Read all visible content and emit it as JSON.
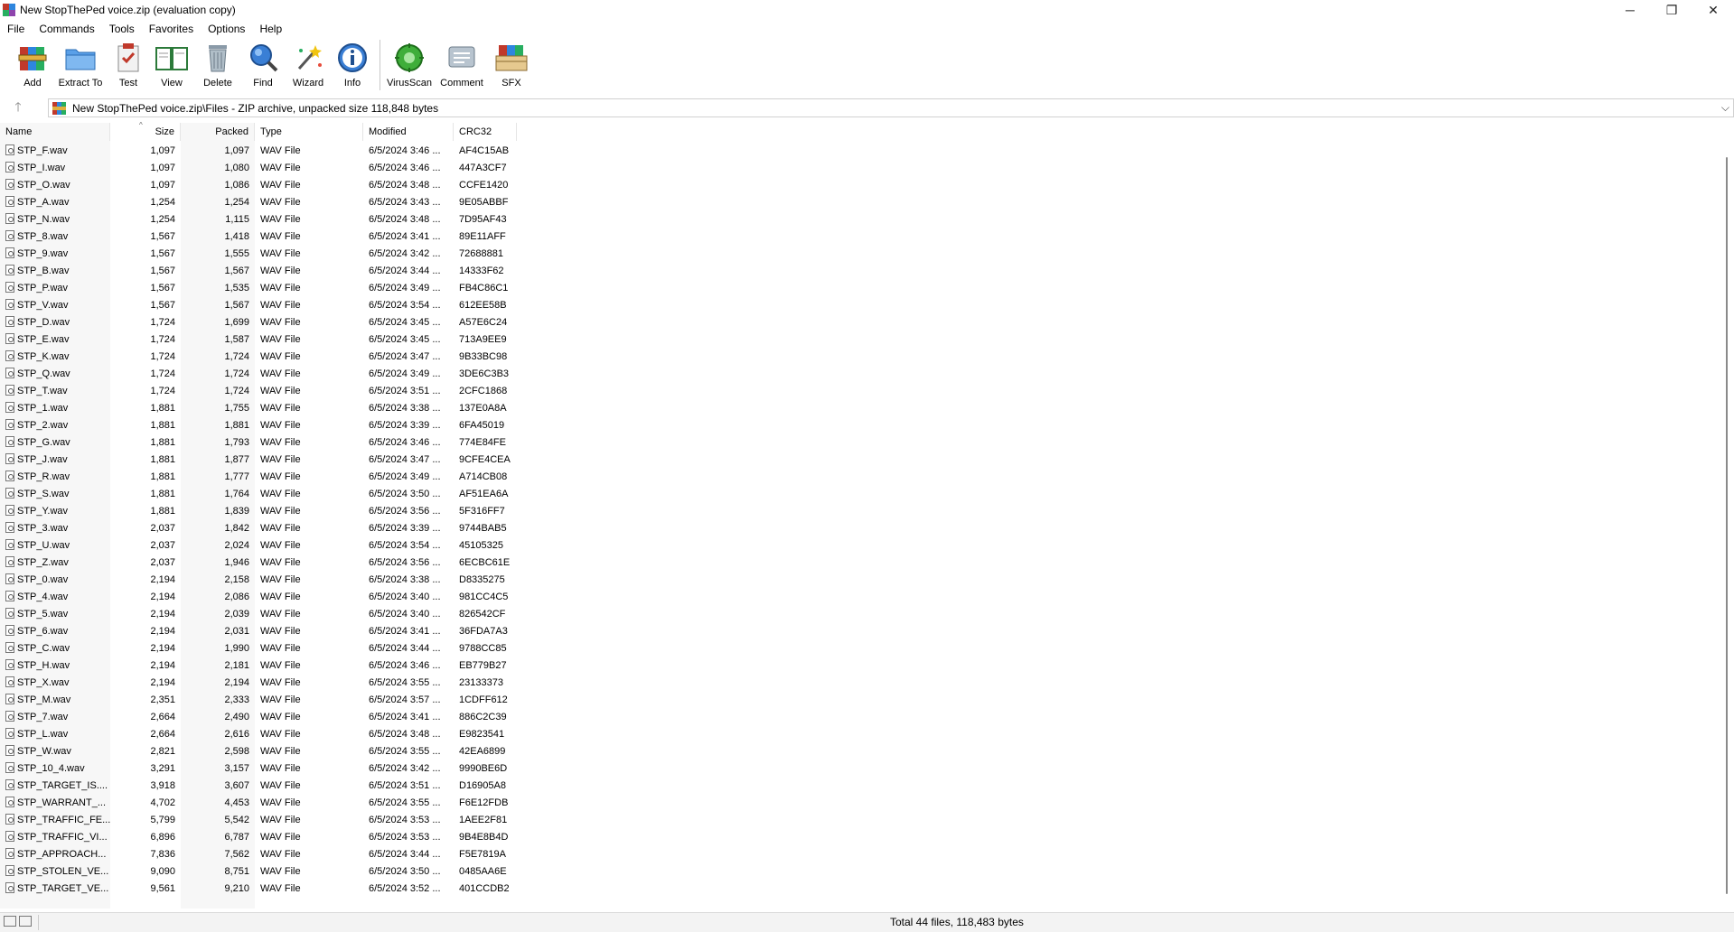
{
  "window": {
    "title": "New StopThePed voice.zip (evaluation copy)",
    "controls": {
      "minimize": "─",
      "maximize": "❐",
      "close": "✕"
    }
  },
  "menu": [
    "File",
    "Commands",
    "Tools",
    "Favorites",
    "Options",
    "Help"
  ],
  "toolbar": {
    "add": "Add",
    "extract": "Extract To",
    "test": "Test",
    "view": "View",
    "delete": "Delete",
    "find": "Find",
    "wizard": "Wizard",
    "info": "Info",
    "virusscan": "VirusScan",
    "comment": "Comment",
    "sfx": "SFX"
  },
  "address": {
    "up": "🡑",
    "path": "New StopThePed voice.zip\\Files - ZIP archive, unpacked size 118,848 bytes",
    "dropdown": "⌵"
  },
  "columns": {
    "name": "Name",
    "size": "Size",
    "packed": "Packed",
    "type": "Type",
    "modified": "Modified",
    "crc": "CRC32",
    "sort_indicator": "^"
  },
  "files": [
    {
      "name": "STP_F.wav",
      "size": "1,097",
      "packed": "1,097",
      "type": "WAV File",
      "modified": "6/5/2024 3:46 ...",
      "crc": "AF4C15AB"
    },
    {
      "name": "STP_I.wav",
      "size": "1,097",
      "packed": "1,080",
      "type": "WAV File",
      "modified": "6/5/2024 3:46 ...",
      "crc": "447A3CF7"
    },
    {
      "name": "STP_O.wav",
      "size": "1,097",
      "packed": "1,086",
      "type": "WAV File",
      "modified": "6/5/2024 3:48 ...",
      "crc": "CCFE1420"
    },
    {
      "name": "STP_A.wav",
      "size": "1,254",
      "packed": "1,254",
      "type": "WAV File",
      "modified": "6/5/2024 3:43 ...",
      "crc": "9E05ABBF"
    },
    {
      "name": "STP_N.wav",
      "size": "1,254",
      "packed": "1,115",
      "type": "WAV File",
      "modified": "6/5/2024 3:48 ...",
      "crc": "7D95AF43"
    },
    {
      "name": "STP_8.wav",
      "size": "1,567",
      "packed": "1,418",
      "type": "WAV File",
      "modified": "6/5/2024 3:41 ...",
      "crc": "89E11AFF"
    },
    {
      "name": "STP_9.wav",
      "size": "1,567",
      "packed": "1,555",
      "type": "WAV File",
      "modified": "6/5/2024 3:42 ...",
      "crc": "72688881"
    },
    {
      "name": "STP_B.wav",
      "size": "1,567",
      "packed": "1,567",
      "type": "WAV File",
      "modified": "6/5/2024 3:44 ...",
      "crc": "14333F62"
    },
    {
      "name": "STP_P.wav",
      "size": "1,567",
      "packed": "1,535",
      "type": "WAV File",
      "modified": "6/5/2024 3:49 ...",
      "crc": "FB4C86C1"
    },
    {
      "name": "STP_V.wav",
      "size": "1,567",
      "packed": "1,567",
      "type": "WAV File",
      "modified": "6/5/2024 3:54 ...",
      "crc": "612EE58B"
    },
    {
      "name": "STP_D.wav",
      "size": "1,724",
      "packed": "1,699",
      "type": "WAV File",
      "modified": "6/5/2024 3:45 ...",
      "crc": "A57E6C24"
    },
    {
      "name": "STP_E.wav",
      "size": "1,724",
      "packed": "1,587",
      "type": "WAV File",
      "modified": "6/5/2024 3:45 ...",
      "crc": "713A9EE9"
    },
    {
      "name": "STP_K.wav",
      "size": "1,724",
      "packed": "1,724",
      "type": "WAV File",
      "modified": "6/5/2024 3:47 ...",
      "crc": "9B33BC98"
    },
    {
      "name": "STP_Q.wav",
      "size": "1,724",
      "packed": "1,724",
      "type": "WAV File",
      "modified": "6/5/2024 3:49 ...",
      "crc": "3DE6C3B3"
    },
    {
      "name": "STP_T.wav",
      "size": "1,724",
      "packed": "1,724",
      "type": "WAV File",
      "modified": "6/5/2024 3:51 ...",
      "crc": "2CFC1868"
    },
    {
      "name": "STP_1.wav",
      "size": "1,881",
      "packed": "1,755",
      "type": "WAV File",
      "modified": "6/5/2024 3:38 ...",
      "crc": "137E0A8A"
    },
    {
      "name": "STP_2.wav",
      "size": "1,881",
      "packed": "1,881",
      "type": "WAV File",
      "modified": "6/5/2024 3:39 ...",
      "crc": "6FA45019"
    },
    {
      "name": "STP_G.wav",
      "size": "1,881",
      "packed": "1,793",
      "type": "WAV File",
      "modified": "6/5/2024 3:46 ...",
      "crc": "774E84FE"
    },
    {
      "name": "STP_J.wav",
      "size": "1,881",
      "packed": "1,877",
      "type": "WAV File",
      "modified": "6/5/2024 3:47 ...",
      "crc": "9CFE4CEA"
    },
    {
      "name": "STP_R.wav",
      "size": "1,881",
      "packed": "1,777",
      "type": "WAV File",
      "modified": "6/5/2024 3:49 ...",
      "crc": "A714CB08"
    },
    {
      "name": "STP_S.wav",
      "size": "1,881",
      "packed": "1,764",
      "type": "WAV File",
      "modified": "6/5/2024 3:50 ...",
      "crc": "AF51EA6A"
    },
    {
      "name": "STP_Y.wav",
      "size": "1,881",
      "packed": "1,839",
      "type": "WAV File",
      "modified": "6/5/2024 3:56 ...",
      "crc": "5F316FF7"
    },
    {
      "name": "STP_3.wav",
      "size": "2,037",
      "packed": "1,842",
      "type": "WAV File",
      "modified": "6/5/2024 3:39 ...",
      "crc": "9744BAB5"
    },
    {
      "name": "STP_U.wav",
      "size": "2,037",
      "packed": "2,024",
      "type": "WAV File",
      "modified": "6/5/2024 3:54 ...",
      "crc": "45105325"
    },
    {
      "name": "STP_Z.wav",
      "size": "2,037",
      "packed": "1,946",
      "type": "WAV File",
      "modified": "6/5/2024 3:56 ...",
      "crc": "6ECBC61E"
    },
    {
      "name": "STP_0.wav",
      "size": "2,194",
      "packed": "2,158",
      "type": "WAV File",
      "modified": "6/5/2024 3:38 ...",
      "crc": "D8335275"
    },
    {
      "name": "STP_4.wav",
      "size": "2,194",
      "packed": "2,086",
      "type": "WAV File",
      "modified": "6/5/2024 3:40 ...",
      "crc": "981CC4C5"
    },
    {
      "name": "STP_5.wav",
      "size": "2,194",
      "packed": "2,039",
      "type": "WAV File",
      "modified": "6/5/2024 3:40 ...",
      "crc": "826542CF"
    },
    {
      "name": "STP_6.wav",
      "size": "2,194",
      "packed": "2,031",
      "type": "WAV File",
      "modified": "6/5/2024 3:41 ...",
      "crc": "36FDA7A3"
    },
    {
      "name": "STP_C.wav",
      "size": "2,194",
      "packed": "1,990",
      "type": "WAV File",
      "modified": "6/5/2024 3:44 ...",
      "crc": "9788CC85"
    },
    {
      "name": "STP_H.wav",
      "size": "2,194",
      "packed": "2,181",
      "type": "WAV File",
      "modified": "6/5/2024 3:46 ...",
      "crc": "EB779B27"
    },
    {
      "name": "STP_X.wav",
      "size": "2,194",
      "packed": "2,194",
      "type": "WAV File",
      "modified": "6/5/2024 3:55 ...",
      "crc": "23133373"
    },
    {
      "name": "STP_M.wav",
      "size": "2,351",
      "packed": "2,333",
      "type": "WAV File",
      "modified": "6/5/2024 3:57 ...",
      "crc": "1CDFF612"
    },
    {
      "name": "STP_7.wav",
      "size": "2,664",
      "packed": "2,490",
      "type": "WAV File",
      "modified": "6/5/2024 3:41 ...",
      "crc": "886C2C39"
    },
    {
      "name": "STP_L.wav",
      "size": "2,664",
      "packed": "2,616",
      "type": "WAV File",
      "modified": "6/5/2024 3:48 ...",
      "crc": "E9823541"
    },
    {
      "name": "STP_W.wav",
      "size": "2,821",
      "packed": "2,598",
      "type": "WAV File",
      "modified": "6/5/2024 3:55 ...",
      "crc": "42EA6899"
    },
    {
      "name": "STP_10_4.wav",
      "size": "3,291",
      "packed": "3,157",
      "type": "WAV File",
      "modified": "6/5/2024 3:42 ...",
      "crc": "9990BE6D"
    },
    {
      "name": "STP_TARGET_IS....",
      "size": "3,918",
      "packed": "3,607",
      "type": "WAV File",
      "modified": "6/5/2024 3:51 ...",
      "crc": "D16905A8"
    },
    {
      "name": "STP_WARRANT_...",
      "size": "4,702",
      "packed": "4,453",
      "type": "WAV File",
      "modified": "6/5/2024 3:55 ...",
      "crc": "F6E12FDB"
    },
    {
      "name": "STP_TRAFFIC_FE...",
      "size": "5,799",
      "packed": "5,542",
      "type": "WAV File",
      "modified": "6/5/2024 3:53 ...",
      "crc": "1AEE2F81"
    },
    {
      "name": "STP_TRAFFIC_VI...",
      "size": "6,896",
      "packed": "6,787",
      "type": "WAV File",
      "modified": "6/5/2024 3:53 ...",
      "crc": "9B4E8B4D"
    },
    {
      "name": "STP_APPROACH...",
      "size": "7,836",
      "packed": "7,562",
      "type": "WAV File",
      "modified": "6/5/2024 3:44 ...",
      "crc": "F5E7819A"
    },
    {
      "name": "STP_STOLEN_VE...",
      "size": "9,090",
      "packed": "8,751",
      "type": "WAV File",
      "modified": "6/5/2024 3:50 ...",
      "crc": "0485AA6E"
    },
    {
      "name": "STP_TARGET_VE...",
      "size": "9,561",
      "packed": "9,210",
      "type": "WAV File",
      "modified": "6/5/2024 3:52 ...",
      "crc": "401CCDB2"
    }
  ],
  "status": {
    "text": "Total 44 files, 118,483 bytes"
  },
  "colors": {
    "alt_column": "#f7f7f7",
    "accent": "#1a5fb4"
  }
}
